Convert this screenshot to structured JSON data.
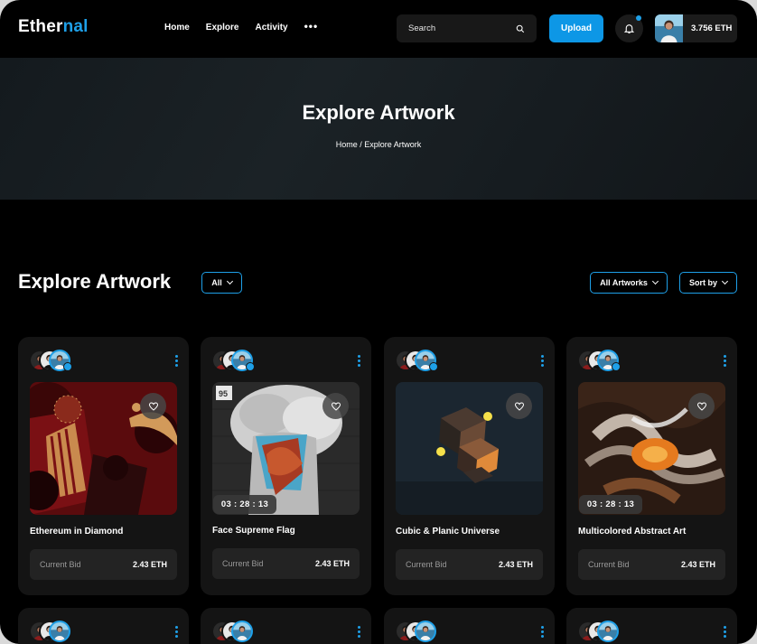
{
  "header": {
    "logo_part1": "Ether",
    "logo_part2": "nal",
    "nav": [
      "Home",
      "Explore",
      "Activity"
    ],
    "more": "•••",
    "search_placeholder": "Search",
    "upload_label": "Upload",
    "balance": "3.756 ETH"
  },
  "hero": {
    "title": "Explore Artwork",
    "breadcrumb": "Home / Explore Artwork"
  },
  "section": {
    "title": "Explore Artwork",
    "filter_all": "All",
    "filter_type": "All Artworks",
    "sort": "Sort by"
  },
  "cards": [
    {
      "title": "Ethereum in Diamond",
      "bid_label": "Current Bid",
      "bid_value": "2.43 ETH",
      "timer": ""
    },
    {
      "title": "Face Supreme Flag",
      "bid_label": "Current Bid",
      "bid_value": "2.43 ETH",
      "timer": "03 : 28 : 13"
    },
    {
      "title": "Cubic & Planic Universe",
      "bid_label": "Current Bid",
      "bid_value": "2.43 ETH",
      "timer": ""
    },
    {
      "title": "Multicolored Abstract Art",
      "bid_label": "Current Bid",
      "bid_value": "2.43 ETH",
      "timer": "03 : 28 : 13"
    }
  ],
  "colors": {
    "accent": "#1ea0e8",
    "card": "#141414",
    "bid_bg": "#232323"
  }
}
